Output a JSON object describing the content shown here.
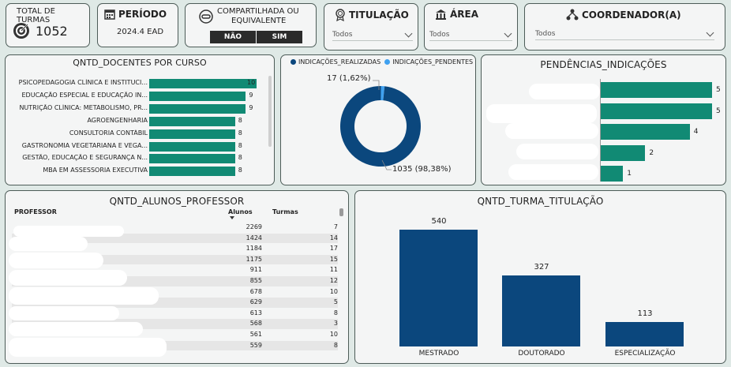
{
  "kpi": {
    "total_turmas_label": "TOTAL DE TURMAS",
    "total_turmas_value": "1052"
  },
  "periodo": {
    "label": "PERÍODO",
    "value": "2024.4 EAD"
  },
  "compartilhada": {
    "label_line1": "COMPARTILHADA OU",
    "label_line2": "EQUIVALENTE",
    "options": [
      "NÃO",
      "SIM"
    ]
  },
  "titulacao": {
    "label": "TITULAÇÃO",
    "value": "Todos"
  },
  "area": {
    "label": "ÁREA",
    "value": "Todos"
  },
  "coordenador": {
    "label": "COORDENADOR(A)",
    "value": "Todos"
  },
  "docentes": {
    "title": "QNTD_DOCENTES POR CURSO",
    "chart_data": {
      "type": "bar",
      "categories": [
        "PSICOPEDAGOGIA CLÍNICA E INSTITUCI...",
        "EDUCAÇÃO ESPECIAL E EDUCAÇÃO IN...",
        "NUTRIÇÃO CLÍNICA: METABOLISMO, PR...",
        "AGROENGENHARIA",
        "CONSULTORIA CONTÁBIL",
        "GASTRONOMIA VEGETARIANA E VEGA...",
        "GESTÃO, EDUCAÇÃO E SEGURANÇA N...",
        "MBA EM ASSESSORIA EXECUTIVA"
      ],
      "values": [
        10,
        9,
        9,
        8,
        8,
        8,
        8,
        8
      ],
      "color": "#118a74"
    }
  },
  "indicacoes": {
    "legend": [
      "INDICAÇÕES_REALIZADAS",
      "INDICAÇÕES_PENDENTES"
    ],
    "colors": [
      "#0b477d",
      "#3fa1f0"
    ],
    "labels": [
      "1035 (98,38%)",
      "17 (1,62%)"
    ],
    "chart_data": {
      "type": "pie",
      "categories": [
        "INDICAÇÕES_REALIZADAS",
        "INDICAÇÕES_PENDENTES"
      ],
      "values": [
        1035,
        17
      ]
    }
  },
  "pendencias": {
    "title": "PENDÊNCIAS_INDICAÇÕES",
    "chart_data": {
      "type": "bar",
      "values": [
        5,
        5,
        4,
        2,
        1
      ],
      "color": "#118a74"
    }
  },
  "alunos": {
    "title": "QNTD_ALUNOS_PROFESSOR",
    "headers": {
      "professor": "PROFESSOR",
      "alunos": "Alunos",
      "turmas": "Turmas"
    },
    "rows": [
      {
        "alunos": "2269",
        "turmas": "7"
      },
      {
        "alunos": "1424",
        "turmas": "14"
      },
      {
        "alunos": "1184",
        "turmas": "17"
      },
      {
        "alunos": "1175",
        "turmas": "15"
      },
      {
        "alunos": "911",
        "turmas": "11"
      },
      {
        "alunos": "855",
        "turmas": "12"
      },
      {
        "alunos": "678",
        "turmas": "10"
      },
      {
        "alunos": "629",
        "turmas": "5"
      },
      {
        "alunos": "613",
        "turmas": "8"
      },
      {
        "alunos": "568",
        "turmas": "3"
      },
      {
        "alunos": "561",
        "turmas": "10"
      },
      {
        "alunos": "559",
        "turmas": "8"
      }
    ]
  },
  "titulacao_chart": {
    "title": "QNTD_TURMA_TITULAÇÃO",
    "chart_data": {
      "type": "bar",
      "categories": [
        "MESTRADO",
        "DOUTORADO",
        "ESPECIALIZAÇÃO"
      ],
      "values": [
        540,
        327,
        113
      ],
      "labels": [
        "540",
        "327",
        "113"
      ],
      "color": "#0b477d"
    }
  }
}
